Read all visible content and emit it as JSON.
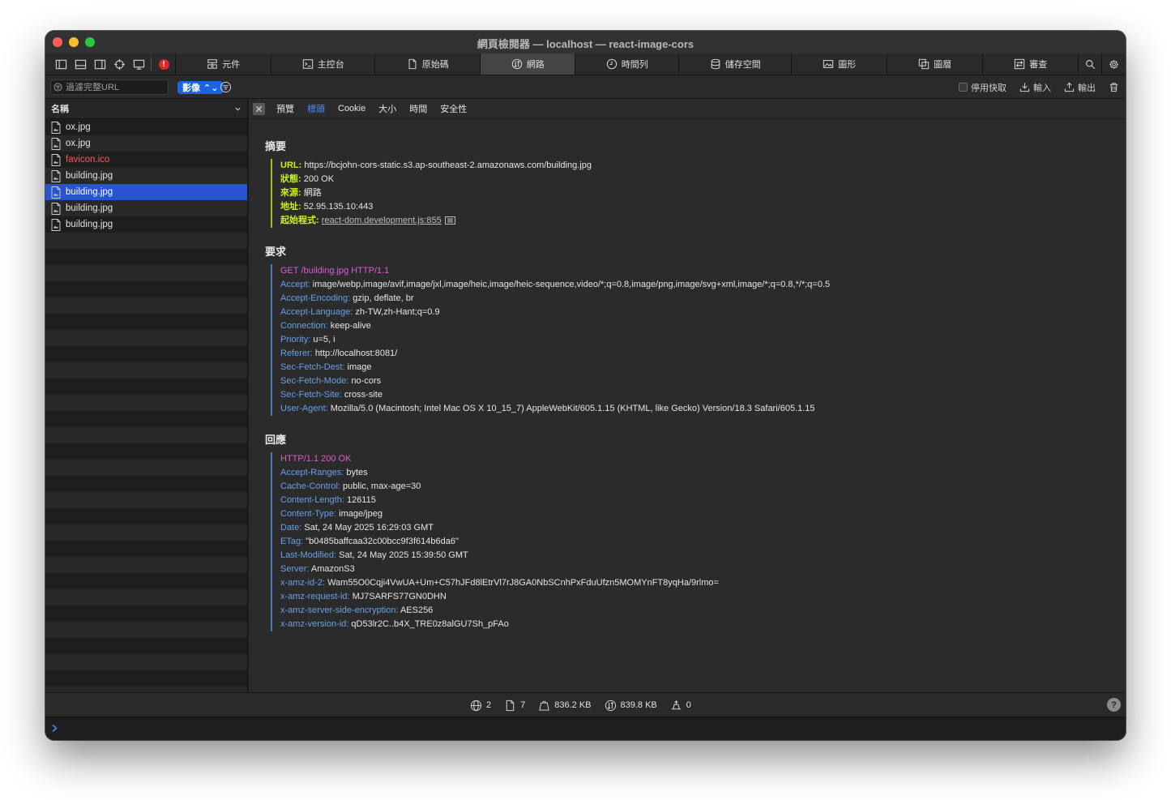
{
  "window": {
    "title": "網頁檢閱器 — localhost — react-image-cors"
  },
  "tabs": [
    {
      "label": "元件",
      "icon": "elements-icon",
      "width": 118
    },
    {
      "label": "主控台",
      "icon": "console-icon",
      "width": 128
    },
    {
      "label": "原始碼",
      "icon": "sources-icon",
      "width": 130
    },
    {
      "label": "網路",
      "icon": "network-icon",
      "width": 117,
      "active": true
    },
    {
      "label": "時間列",
      "icon": "timelines-icon",
      "width": 128
    },
    {
      "label": "儲存空間",
      "icon": "storage-icon",
      "width": 139
    },
    {
      "label": "圖形",
      "icon": "graphics-icon",
      "width": 118
    },
    {
      "label": "圖層",
      "icon": "layers-icon",
      "width": 118
    },
    {
      "label": "審查",
      "icon": "audit-icon",
      "width": 118
    }
  ],
  "filter": {
    "placeholder": "過濾完整URL",
    "type_select": "影像",
    "disable_cache": "停用快取",
    "import": "輸入",
    "export": "輸出"
  },
  "list": {
    "header": "名稱",
    "items": [
      {
        "name": "ox.jpg",
        "state": "normal"
      },
      {
        "name": "ox.jpg",
        "state": "normal"
      },
      {
        "name": "favicon.ico",
        "state": "error"
      },
      {
        "name": "building.jpg",
        "state": "normal"
      },
      {
        "name": "building.jpg",
        "state": "selected"
      },
      {
        "name": "building.jpg",
        "state": "normal"
      },
      {
        "name": "building.jpg",
        "state": "normal"
      }
    ]
  },
  "detail_tabs": [
    {
      "label": "預覽"
    },
    {
      "label": "標頭",
      "active": true
    },
    {
      "label": "Cookie"
    },
    {
      "label": "大小"
    },
    {
      "label": "時間"
    },
    {
      "label": "安全性"
    }
  ],
  "summary": {
    "title": "摘要",
    "url_key": "URL:",
    "url": "https://bcjohn-cors-static.s3.ap-southeast-2.amazonaws.com/building.jpg",
    "status_key": "狀態:",
    "status": "200 OK",
    "source_key": "來源:",
    "source": "網路",
    "address_key": "地址:",
    "address": "52.95.135.10:443",
    "initiator_key": "起始程式:",
    "initiator": "react-dom.development.js:855"
  },
  "request": {
    "title": "要求",
    "line": "GET /building.jpg HTTP/1.1",
    "headers": [
      {
        "k": "Accept:",
        "v": "image/webp,image/avif,image/jxl,image/heic,image/heic-sequence,video/*;q=0.8,image/png,image/svg+xml,image/*;q=0.8,*/*;q=0.5"
      },
      {
        "k": "Accept-Encoding:",
        "v": "gzip, deflate, br"
      },
      {
        "k": "Accept-Language:",
        "v": "zh-TW,zh-Hant;q=0.9"
      },
      {
        "k": "Connection:",
        "v": "keep-alive"
      },
      {
        "k": "Priority:",
        "v": "u=5, i"
      },
      {
        "k": "Referer:",
        "v": "http://localhost:8081/"
      },
      {
        "k": "Sec-Fetch-Dest:",
        "v": "image"
      },
      {
        "k": "Sec-Fetch-Mode:",
        "v": "no-cors"
      },
      {
        "k": "Sec-Fetch-Site:",
        "v": "cross-site"
      },
      {
        "k": "User-Agent:",
        "v": "Mozilla/5.0 (Macintosh; Intel Mac OS X 10_15_7) AppleWebKit/605.1.15 (KHTML, like Gecko) Version/18.3 Safari/605.1.15"
      }
    ]
  },
  "response": {
    "title": "回應",
    "line": "HTTP/1.1 200 OK",
    "headers": [
      {
        "k": "Accept-Ranges:",
        "v": "bytes"
      },
      {
        "k": "Cache-Control:",
        "v": "public, max-age=30"
      },
      {
        "k": "Content-Length:",
        "v": "126115"
      },
      {
        "k": "Content-Type:",
        "v": "image/jpeg"
      },
      {
        "k": "Date:",
        "v": "Sat, 24 May 2025 16:29:03 GMT"
      },
      {
        "k": "ETag:",
        "v": "\"b0485baffcaa32c00bcc9f3f614b6da6\""
      },
      {
        "k": "Last-Modified:",
        "v": "Sat, 24 May 2025 15:39:50 GMT"
      },
      {
        "k": "Server:",
        "v": "AmazonS3"
      },
      {
        "k": "x-amz-id-2:",
        "v": "Wam55O0Cqji4VwUA+Um+C57hJFd8lEtrVl7rJ8GA0NbSCnhPxFduUfzn5MOMYnFT8yqHa/9rlmo="
      },
      {
        "k": "x-amz-request-id:",
        "v": "MJ7SARFS77GN0DHN"
      },
      {
        "k": "x-amz-server-side-encryption:",
        "v": "AES256"
      },
      {
        "k": "x-amz-version-id:",
        "v": "qD53lr2C..b4X_TRE0z8alGU7Sh_pFAo"
      }
    ]
  },
  "status": {
    "domains": "2",
    "resources": "7",
    "transferred": "836.2 KB",
    "size": "839.8 KB",
    "redirects": "0",
    "help": "?"
  },
  "colors": {
    "accent": "#2754d1",
    "header_key": "#6aa0e6",
    "summary_key": "#c8f020",
    "status_line": "#e05ad2",
    "error": "#ff5a5a"
  }
}
